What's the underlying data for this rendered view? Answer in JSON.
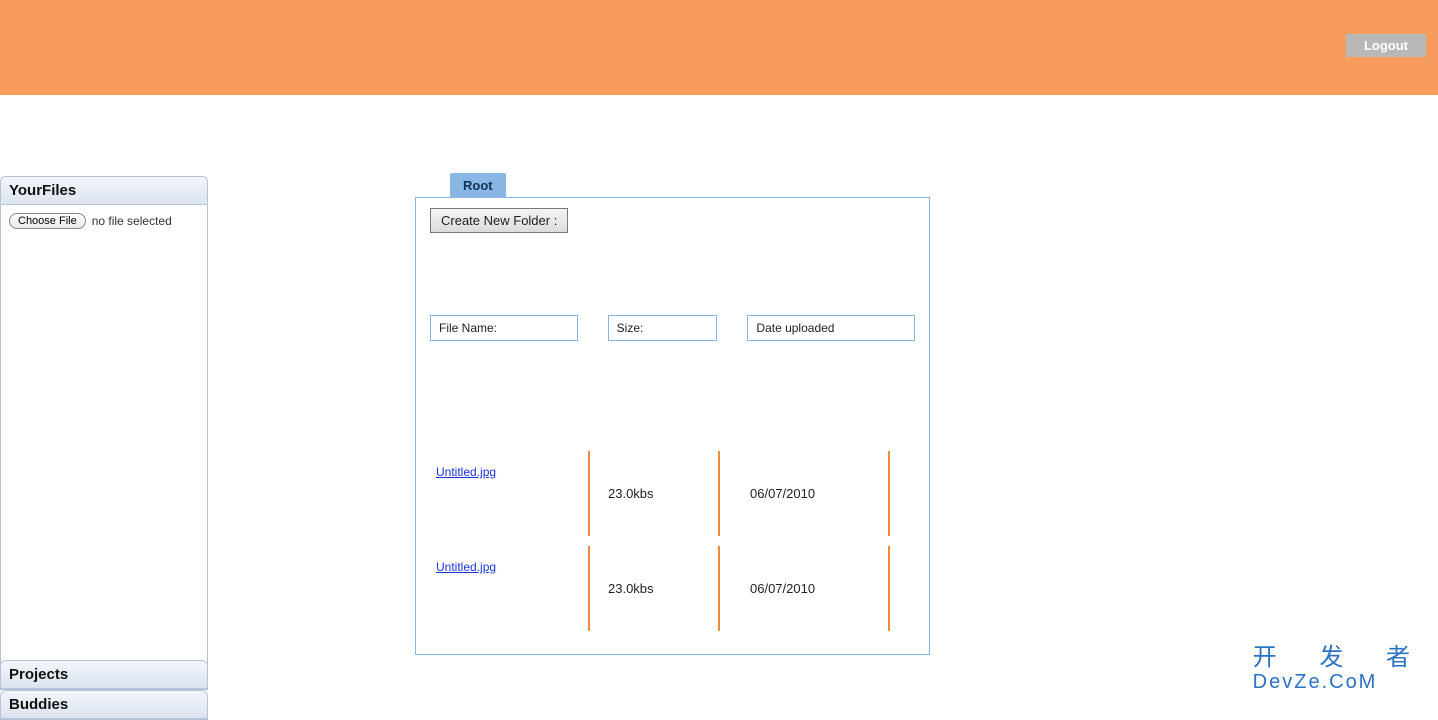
{
  "header": {
    "logout_label": "Logout"
  },
  "sidebar": {
    "your_files_title": "YourFiles",
    "choose_file_label": "Choose File",
    "file_status_text": "no file selected",
    "projects_title": "Projects",
    "buddies_title": "Buddies"
  },
  "main": {
    "tab_label": "Root",
    "create_folder_label": "Create New Folder :",
    "columns": {
      "name": "File Name:",
      "size": "Size:",
      "date": "Date uploaded"
    },
    "files": [
      {
        "name": "Untitled.jpg",
        "size": "23.0kbs",
        "date": "06/07/2010"
      },
      {
        "name": "Untitled.jpg",
        "size": "23.0kbs",
        "date": "06/07/2010"
      }
    ]
  },
  "watermark": {
    "line1": "开 发 者",
    "line2": "DevZe.CoM"
  }
}
